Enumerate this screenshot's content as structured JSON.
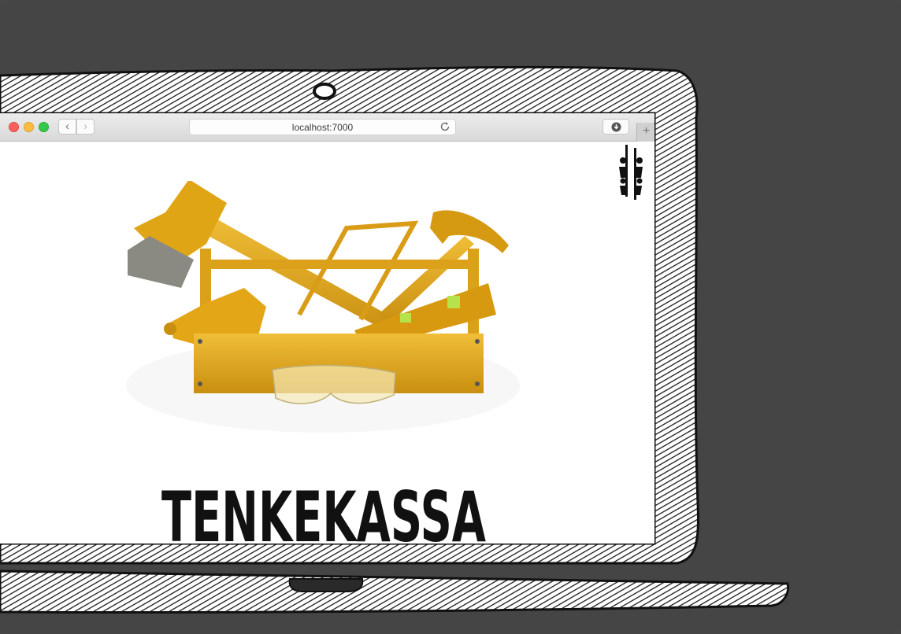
{
  "browser": {
    "url": "localhost:7000",
    "new_tab_label": "+",
    "back_label": "‹",
    "forward_label": "›"
  },
  "page": {
    "wordmark": "TENKEKASSA",
    "hero_image": "yellow-toolbox-with-tools",
    "logo_icon": "brand-figures-icon"
  },
  "colors": {
    "tool_yellow": "#E2A91B",
    "backdrop": "#454545",
    "ink": "#111111"
  }
}
